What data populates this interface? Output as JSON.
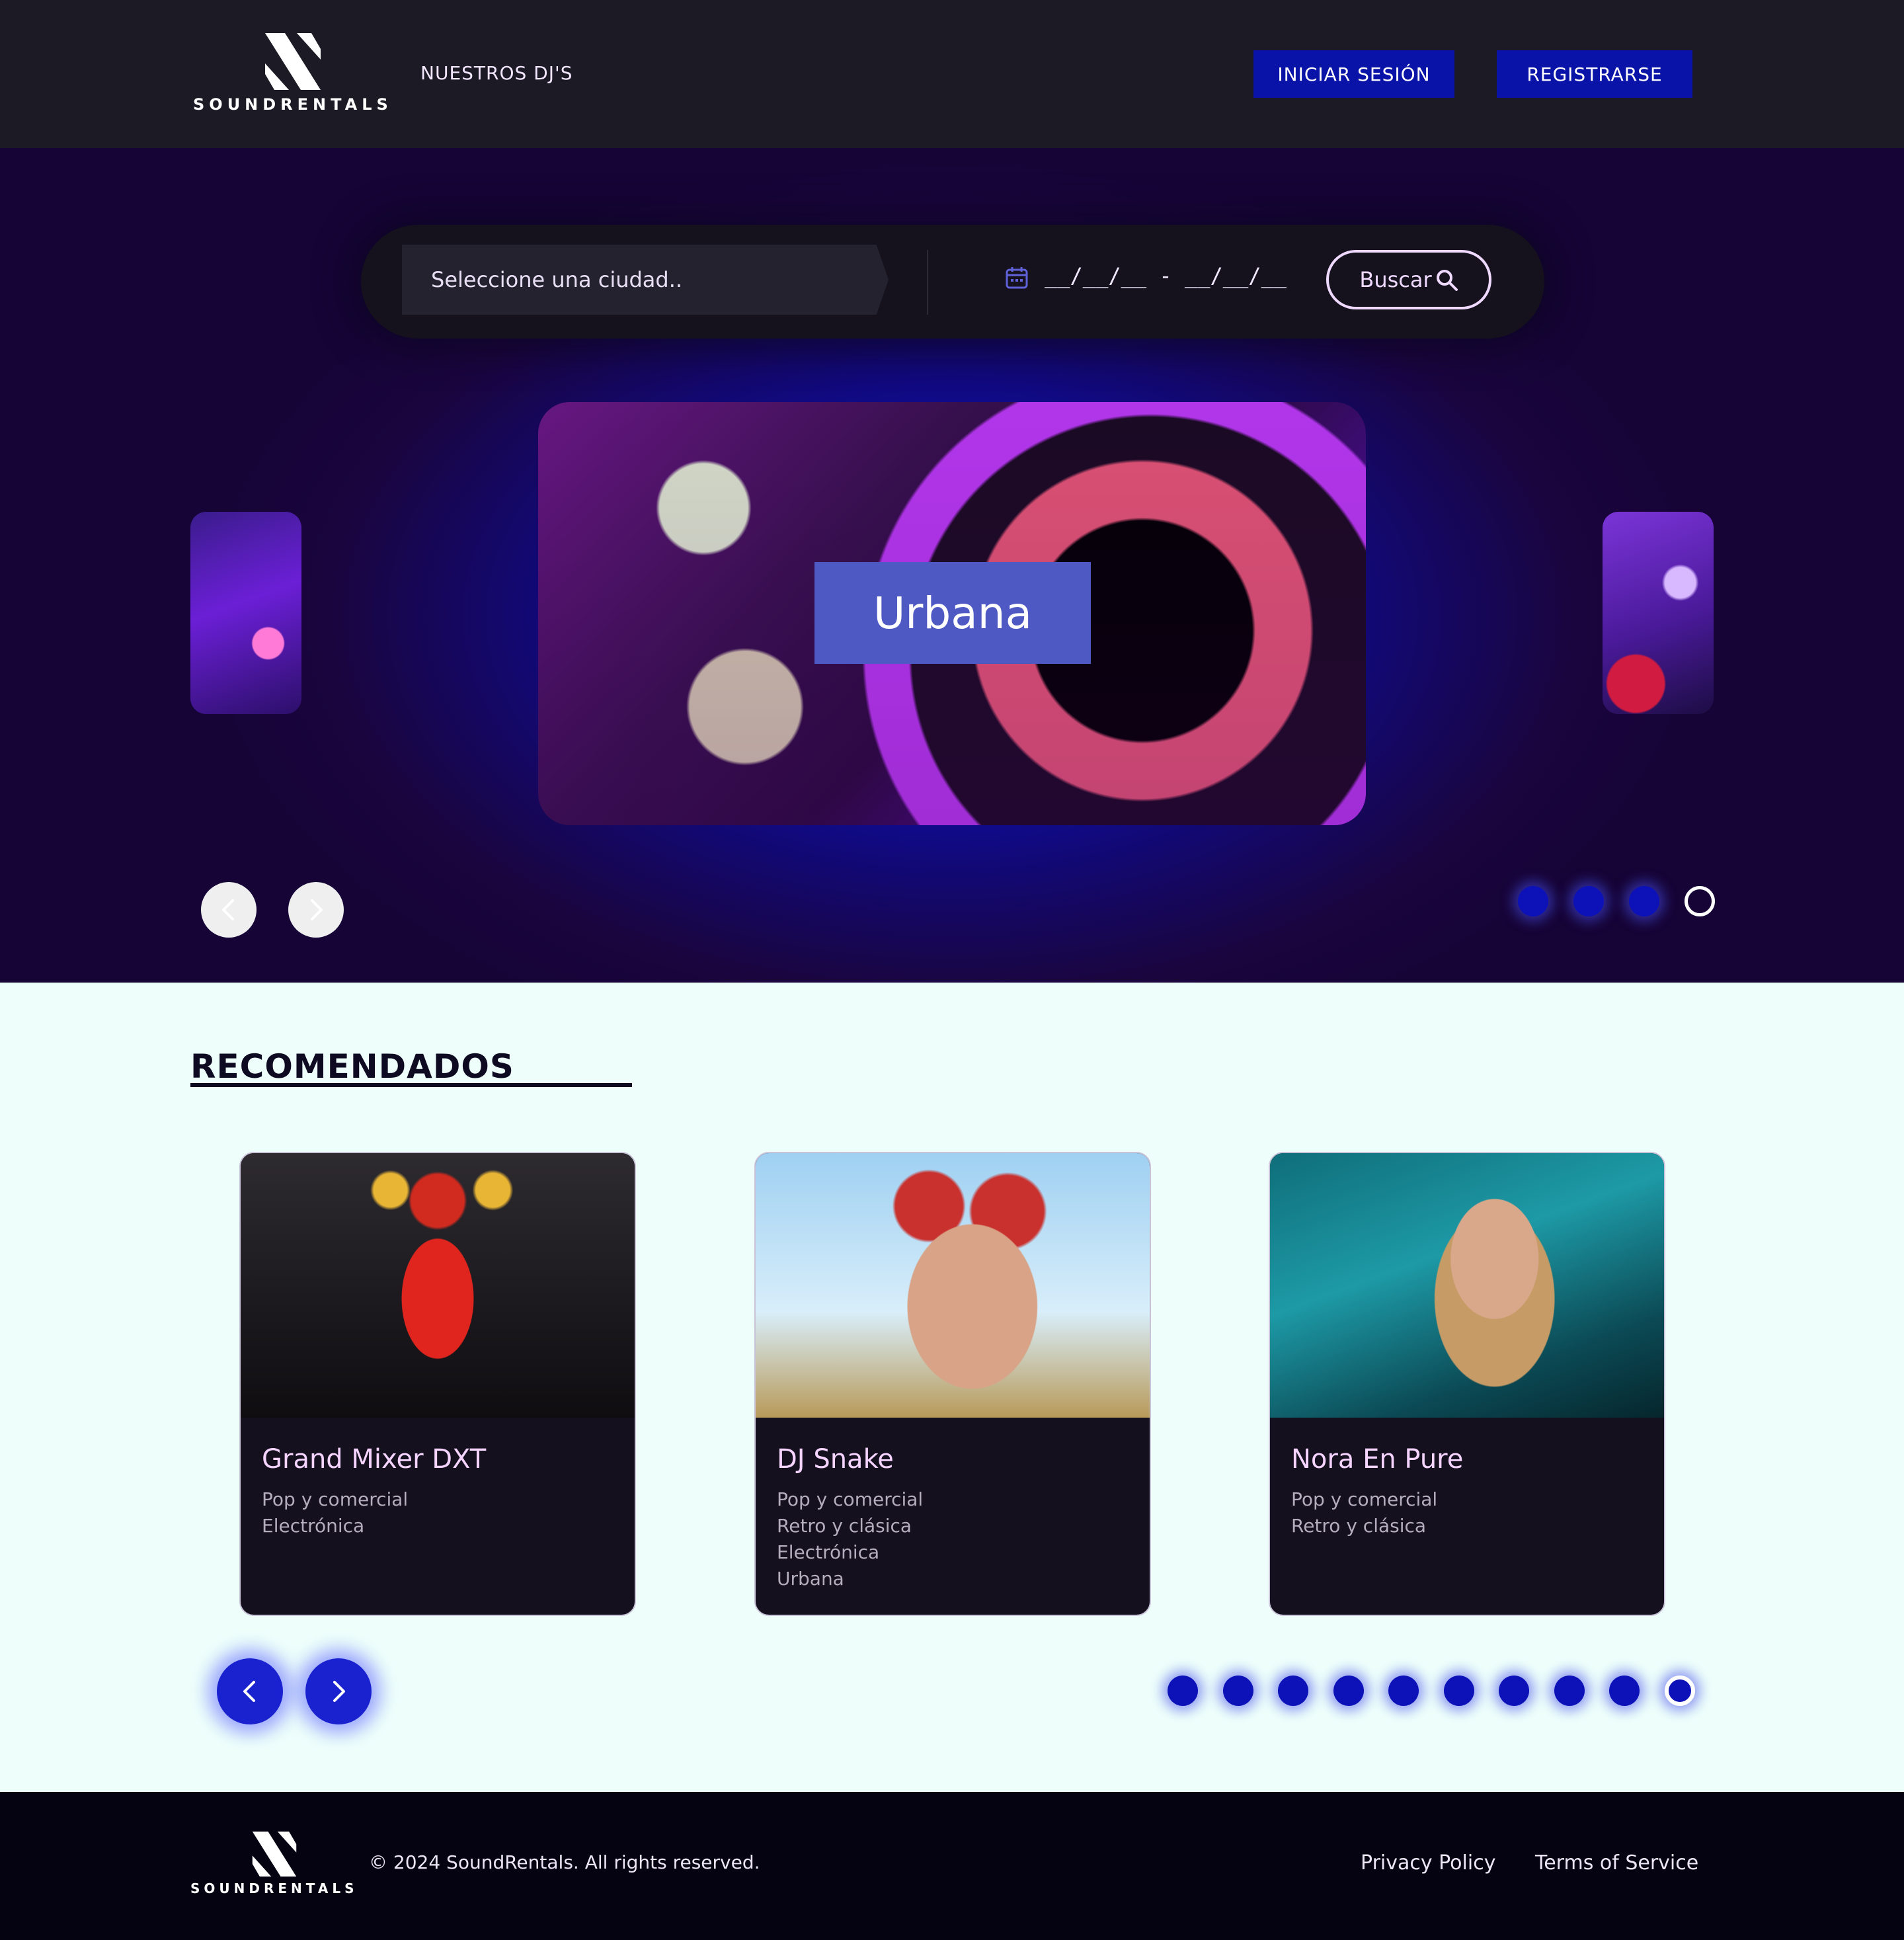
{
  "header": {
    "logo_text": "SOUNDRENTALS",
    "nav_link": "NUESTROS DJ'S",
    "login_label": "INICIAR SESIÓN",
    "register_label": "REGISTRARSE"
  },
  "search": {
    "city_placeholder": "Seleccione una ciudad..",
    "date_range": "__/__/__ - __/__/__",
    "button_label": "Buscar",
    "icons": [
      "calendar-icon",
      "search-icon"
    ]
  },
  "hero_carousel": {
    "current_label": "Urbana",
    "total_slides": 4,
    "active_index": 3,
    "icons": [
      "chevron-left-icon",
      "chevron-right-icon"
    ]
  },
  "recommended": {
    "title": "RECOMENDADOS",
    "cards": [
      {
        "name": "Grand Mixer DXT",
        "genres": [
          "Pop y comercial",
          "Electrónica"
        ]
      },
      {
        "name": "DJ Snake",
        "genres": [
          "Pop y comercial",
          "Retro y clásica",
          "Electrónica",
          "Urbana"
        ]
      },
      {
        "name": "Nora En Pure",
        "genres": [
          "Pop y comercial",
          "Retro y clásica"
        ]
      }
    ],
    "total_pages": 10,
    "active_index": 9
  },
  "footer": {
    "logo_text": "SOUNDRENTALS",
    "copyright": "© 2024 SoundRentals. All rights reserved.",
    "privacy_label": "Privacy Policy",
    "terms_label": "Terms of Service"
  },
  "colors": {
    "header_bg": "#1c1b25",
    "button_blue": "#0a13a8",
    "hero_glow": "#0f12d6",
    "accent_pink": "#f5d4ff",
    "section_bg": "#eefffb",
    "footer_bg": "#050212",
    "slide_label_bg": "#4f59c4"
  }
}
